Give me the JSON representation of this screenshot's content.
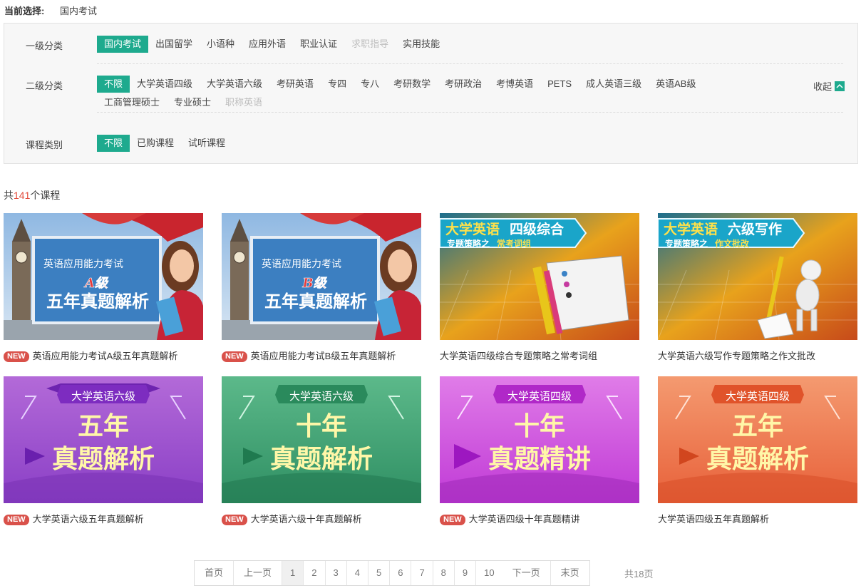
{
  "current": {
    "label": "当前选择:",
    "value": "国内考试"
  },
  "filters": {
    "level1": {
      "label": "一级分类",
      "options": [
        "国内考试",
        "出国留学",
        "小语种",
        "应用外语",
        "职业认证",
        "求职指导",
        "实用技能"
      ]
    },
    "level2": {
      "label": "二级分类",
      "row1": [
        "不限",
        "大学英语四级",
        "大学英语六级",
        "考研英语",
        "专四",
        "专八",
        "考研数学",
        "考研政治",
        "考博英语",
        "PETS",
        "成人英语三级",
        "英语AB级"
      ],
      "row2": [
        "工商管理硕士",
        "专业硕士",
        "职称英语"
      ]
    },
    "course_type": {
      "label": "课程类别",
      "options": [
        "不限",
        "已购课程",
        "试听课程"
      ]
    },
    "collapse_label": "收起"
  },
  "count": {
    "prefix": "共",
    "number": "141",
    "suffix": "个课程"
  },
  "new_badge": "NEW",
  "courses": [
    {
      "title": "英语应用能力考试A级五年真题解析",
      "is_new": true,
      "banner_subtitle": "英语应用能力考试",
      "banner_level": "A级",
      "banner_main": "五年真题解析"
    },
    {
      "title": "英语应用能力考试B级五年真题解析",
      "is_new": true,
      "banner_subtitle": "英语应用能力考试",
      "banner_level": "B级",
      "banner_main": "五年真题解析"
    },
    {
      "title": "大学英语四级综合专题策略之常考词组",
      "is_new": false,
      "banner_a": "大学英语",
      "banner_b": "四级综合",
      "banner_c": "专题策略之",
      "banner_d": "常考词组"
    },
    {
      "title": "大学英语六级写作专题策略之作文批改",
      "is_new": false,
      "banner_a": "大学英语",
      "banner_b": "六级写作",
      "banner_c": "专题策略之",
      "banner_d": "作文批改"
    },
    {
      "title": "大学英语六级五年真题解析",
      "is_new": true,
      "banner_tag": "大学英语六级",
      "banner_l1": "五年",
      "banner_l2": "真题解析"
    },
    {
      "title": "大学英语六级十年真题解析",
      "is_new": true,
      "banner_tag": "大学英语六级",
      "banner_l1": "十年",
      "banner_l2": "真题解析"
    },
    {
      "title": "大学英语四级十年真题精讲",
      "is_new": true,
      "banner_tag": "大学英语四级",
      "banner_l1": "十年",
      "banner_l2": "真题精讲"
    },
    {
      "title": "大学英语四级五年真题解析",
      "is_new": false,
      "banner_tag": "大学英语四级",
      "banner_l1": "五年",
      "banner_l2": "真题解析"
    }
  ],
  "pager": {
    "first": "首页",
    "prev": "上一页",
    "pages": [
      "1",
      "2",
      "3",
      "4",
      "5",
      "6",
      "7",
      "8",
      "9",
      "10"
    ],
    "current": "1",
    "next": "下一页",
    "last": "末页",
    "total": "共18页"
  },
  "colors": {
    "accent": "#1eaa8e",
    "new_badge": "#d9514a",
    "count_number": "#e24b3b"
  }
}
